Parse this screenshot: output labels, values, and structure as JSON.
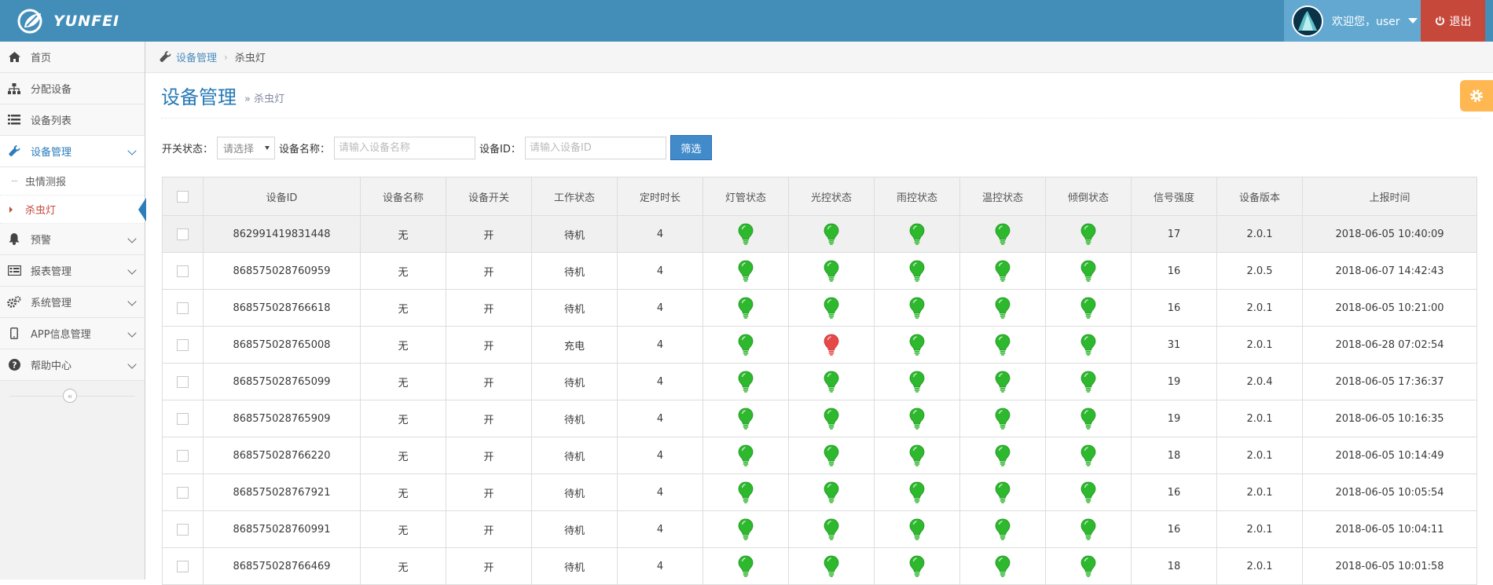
{
  "brand": {
    "name": "YUNFEI"
  },
  "user": {
    "welcome": "欢迎您，user",
    "logout_label": "退出"
  },
  "colors": {
    "navbar": "#438eb9",
    "accent": "#2b7dbc",
    "logout": "#c6483b",
    "bulb_on": "#2db82d",
    "bulb_alarm": "#e74848",
    "settings": "#ffb752"
  },
  "sidebar": {
    "items": [
      {
        "label": "首页",
        "icon": "home-icon"
      },
      {
        "label": "分配设备",
        "icon": "sitemap-icon"
      },
      {
        "label": "设备列表",
        "icon": "list-icon"
      },
      {
        "label": "设备管理",
        "icon": "wrench-icon",
        "expanded": true,
        "children": [
          {
            "label": "虫情测报"
          },
          {
            "label": "杀虫灯",
            "active": true
          }
        ]
      },
      {
        "label": "预警",
        "icon": "bell-icon"
      },
      {
        "label": "报表管理",
        "icon": "report-icon"
      },
      {
        "label": "系统管理",
        "icon": "gears-icon"
      },
      {
        "label": "APP信息管理",
        "icon": "mobile-icon"
      },
      {
        "label": "帮助中心",
        "icon": "question-icon"
      }
    ],
    "collapse_glyph": "«"
  },
  "breadcrumb": {
    "parent": "设备管理",
    "current": "杀虫灯"
  },
  "page_header": {
    "title": "设备管理",
    "subtitle": "» 杀虫灯"
  },
  "filter": {
    "switch_label": "开关状态：",
    "switch_value": "请选择",
    "name_label": "设备名称：",
    "name_placeholder": "请输入设备名称",
    "id_label": "设备ID：",
    "id_placeholder": "请输入设备ID",
    "submit_label": "筛选"
  },
  "table": {
    "columns": [
      "设备ID",
      "设备名称",
      "设备开关",
      "工作状态",
      "定时时长",
      "灯管状态",
      "光控状态",
      "雨控状态",
      "温控状态",
      "倾倒状态",
      "信号强度",
      "设备版本",
      "上报时间"
    ],
    "rows": [
      {
        "id": "862991419831448",
        "name": "无",
        "switch": "开",
        "work": "待机",
        "timer": "4",
        "lamps": [
          "on",
          "on",
          "on",
          "on",
          "on"
        ],
        "signal": "17",
        "version": "2.0.1",
        "time": "2018-06-05 10:40:09"
      },
      {
        "id": "868575028760959",
        "name": "无",
        "switch": "开",
        "work": "待机",
        "timer": "4",
        "lamps": [
          "on",
          "on",
          "on",
          "on",
          "on"
        ],
        "signal": "16",
        "version": "2.0.5",
        "time": "2018-06-07 14:42:43"
      },
      {
        "id": "868575028766618",
        "name": "无",
        "switch": "开",
        "work": "待机",
        "timer": "4",
        "lamps": [
          "on",
          "on",
          "on",
          "on",
          "on"
        ],
        "signal": "16",
        "version": "2.0.1",
        "time": "2018-06-05 10:21:00"
      },
      {
        "id": "868575028765008",
        "name": "无",
        "switch": "开",
        "work": "充电",
        "timer": "4",
        "lamps": [
          "on",
          "alarm",
          "on",
          "on",
          "on"
        ],
        "signal": "31",
        "version": "2.0.1",
        "time": "2018-06-28 07:02:54"
      },
      {
        "id": "868575028765099",
        "name": "无",
        "switch": "开",
        "work": "待机",
        "timer": "4",
        "lamps": [
          "on",
          "on",
          "on",
          "on",
          "on"
        ],
        "signal": "19",
        "version": "2.0.4",
        "time": "2018-06-05 17:36:37"
      },
      {
        "id": "868575028765909",
        "name": "无",
        "switch": "开",
        "work": "待机",
        "timer": "4",
        "lamps": [
          "on",
          "on",
          "on",
          "on",
          "on"
        ],
        "signal": "19",
        "version": "2.0.1",
        "time": "2018-06-05 10:16:35"
      },
      {
        "id": "868575028766220",
        "name": "无",
        "switch": "开",
        "work": "待机",
        "timer": "4",
        "lamps": [
          "on",
          "on",
          "on",
          "on",
          "on"
        ],
        "signal": "18",
        "version": "2.0.1",
        "time": "2018-06-05 10:14:49"
      },
      {
        "id": "868575028767921",
        "name": "无",
        "switch": "开",
        "work": "待机",
        "timer": "4",
        "lamps": [
          "on",
          "on",
          "on",
          "on",
          "on"
        ],
        "signal": "16",
        "version": "2.0.1",
        "time": "2018-06-05 10:05:54"
      },
      {
        "id": "868575028760991",
        "name": "无",
        "switch": "开",
        "work": "待机",
        "timer": "4",
        "lamps": [
          "on",
          "on",
          "on",
          "on",
          "on"
        ],
        "signal": "16",
        "version": "2.0.1",
        "time": "2018-06-05 10:04:11"
      },
      {
        "id": "868575028766469",
        "name": "无",
        "switch": "开",
        "work": "待机",
        "timer": "4",
        "lamps": [
          "on",
          "on",
          "on",
          "on",
          "on"
        ],
        "signal": "18",
        "version": "2.0.1",
        "time": "2018-06-05 10:01:58"
      }
    ]
  }
}
